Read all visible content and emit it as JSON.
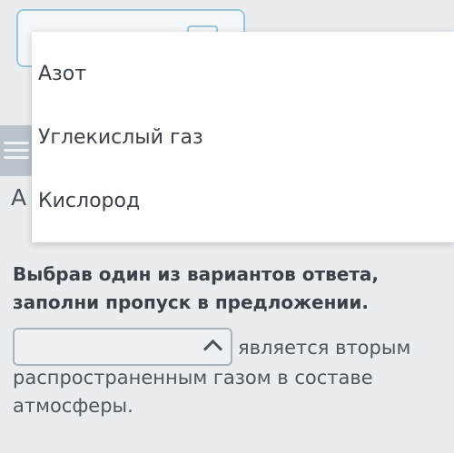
{
  "dropdown": {
    "options": [
      "Азот",
      "Углекислый газ",
      "Кислород"
    ]
  },
  "background": {
    "partial_letter": "А"
  },
  "question": {
    "instruction": "Выбрав один из вариантов ответа, заполни пропуск в предложении.",
    "sentence_after_blank_line1": "является вторым",
    "sentence_after_blank_rest": "распространенным газом в составе атмосферы."
  },
  "icons": {
    "select_toggle": "chevron-up-icon",
    "menu": "menu-icon"
  },
  "colors": {
    "background": "#eaedef",
    "focus_border": "#9cc4da",
    "text": "#3a4148"
  }
}
